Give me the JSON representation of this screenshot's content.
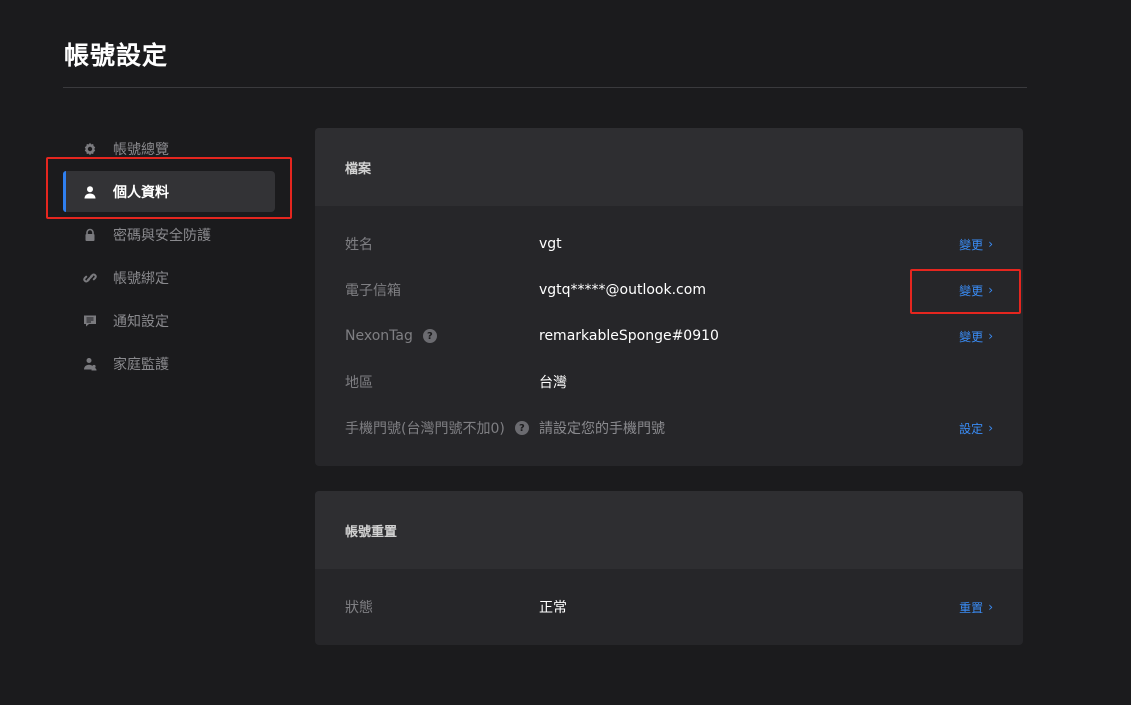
{
  "page": {
    "title": "帳號設定"
  },
  "sidebar": {
    "items": [
      {
        "label": "帳號總覽",
        "icon": "gear-icon"
      },
      {
        "label": "個人資料",
        "icon": "user-icon",
        "active": true
      },
      {
        "label": "密碼與安全防護",
        "icon": "lock-icon"
      },
      {
        "label": "帳號綁定",
        "icon": "link-icon"
      },
      {
        "label": "通知設定",
        "icon": "message-icon"
      },
      {
        "label": "家庭監護",
        "icon": "family-icon"
      }
    ]
  },
  "profile": {
    "header": "檔案",
    "rows": [
      {
        "label": "姓名",
        "value": "vgt",
        "action": "變更"
      },
      {
        "label": "電子信箱",
        "value": "vgtq*****@outlook.com",
        "action": "變更"
      },
      {
        "label": "NexonTag",
        "value": "remarkableSponge#0910",
        "action": "變更",
        "help": "?"
      },
      {
        "label": "地區",
        "value": "台灣"
      },
      {
        "label": "手機門號(台灣門號不加0)",
        "value": "請設定您的手機門號",
        "action": "設定",
        "help": "?"
      }
    ]
  },
  "reset": {
    "header": "帳號重置",
    "rows": [
      {
        "label": "狀態",
        "value": "正常",
        "action": "重置"
      }
    ]
  },
  "colors": {
    "accent": "#3a8cf5",
    "highlight": "#e5261f",
    "background": "#1b1b1d"
  }
}
